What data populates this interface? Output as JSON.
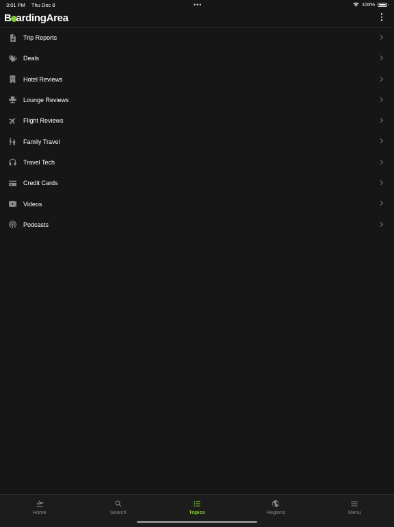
{
  "status": {
    "time": "3:01 PM",
    "date": "Thu Dec 8",
    "battery": "100%",
    "battery_level": 1.0,
    "dots": "•••"
  },
  "header": {
    "logo_pre": "B",
    "logo_post": "ardingArea",
    "menu_icon": "more-vertical-icon"
  },
  "topics": [
    {
      "label": "Trip Reports",
      "icon": "document-icon"
    },
    {
      "label": "Deals",
      "icon": "tag-icon"
    },
    {
      "label": "Hotel Reviews",
      "icon": "building-icon"
    },
    {
      "label": "Lounge Reviews",
      "icon": "lounge-chair-icon"
    },
    {
      "label": "Flight Reviews",
      "icon": "airplane-icon"
    },
    {
      "label": "Family Travel",
      "icon": "family-icon"
    },
    {
      "label": "Travel Tech",
      "icon": "headphones-icon"
    },
    {
      "label": "Credit Cards",
      "icon": "credit-card-icon"
    },
    {
      "label": "Videos",
      "icon": "video-icon"
    },
    {
      "label": "Podcasts",
      "icon": "podcast-icon"
    }
  ],
  "tabs": [
    {
      "label": "Home",
      "icon": "airplane-landing-icon",
      "active": false
    },
    {
      "label": "Search",
      "icon": "search-icon",
      "active": false
    },
    {
      "label": "Topics",
      "icon": "list-icon",
      "active": true
    },
    {
      "label": "Regions",
      "icon": "globe-icon",
      "active": false
    },
    {
      "label": "Menu",
      "icon": "hamburger-icon",
      "active": false
    }
  ],
  "colors": {
    "background": "#161616",
    "accent": "#7ed321",
    "logo_dot": "#7ecb3a",
    "icon": "#8e8e8e"
  }
}
